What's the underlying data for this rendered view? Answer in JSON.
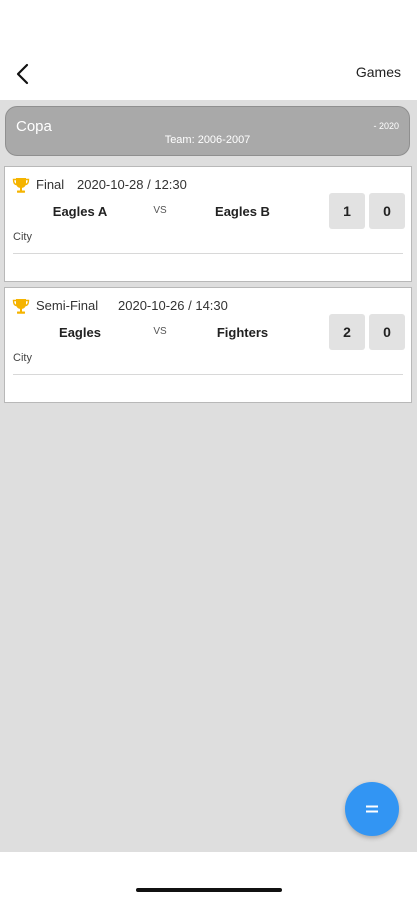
{
  "header": {
    "title": "Games",
    "back_icon": "chevron-left-icon"
  },
  "competition": {
    "name": "Copa",
    "team": "Team: 2006-2007",
    "year": "- 2020",
    "background": "#a9a9a9"
  },
  "games": [
    {
      "round": "Final",
      "date": "2020-10-28 / 12:30",
      "home_team": "Eagles A",
      "vs": "VS",
      "away_team": "Eagles B",
      "home_score": "1",
      "away_score": "0",
      "city": "City",
      "icon": "trophy-icon"
    },
    {
      "round": "Semi-Final",
      "date": "2020-10-26 / 14:30",
      "home_team": "Eagles",
      "vs": "VS",
      "away_team": "Fighters",
      "home_score": "2",
      "away_score": "0",
      "city": "City",
      "icon": "trophy-icon"
    }
  ],
  "fab": {
    "icon": "menu-icon",
    "color": "#3295f3"
  },
  "colors": {
    "content_background": "#dedede",
    "trophy": "#f5b400"
  }
}
